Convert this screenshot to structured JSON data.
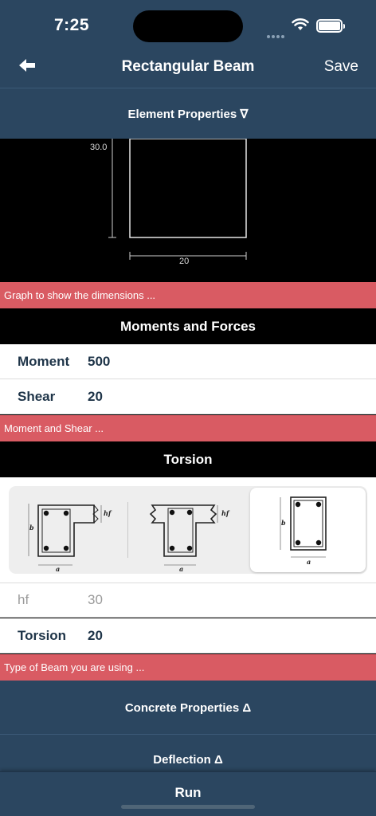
{
  "status_bar": {
    "time": "7:25",
    "icons": [
      "cellular-icon",
      "wifi-icon",
      "battery-icon"
    ]
  },
  "nav": {
    "back_icon": "arrow-left-icon",
    "title": "Rectangular Beam",
    "save_label": "Save"
  },
  "sections": {
    "element_properties": "Element Properties ∇",
    "concrete_properties": "Concrete Properties Δ",
    "deflection": "Deflection Δ"
  },
  "graph": {
    "height_label": "30.0",
    "width_label": "20",
    "hint": "Graph to show the dimensions ..."
  },
  "moments": {
    "header": "Moments and Forces",
    "rows": [
      {
        "label": "Moment",
        "value": "500"
      },
      {
        "label": "Shear",
        "value": "20"
      }
    ],
    "hint": "Moment and Shear ..."
  },
  "torsion": {
    "header": "Torsion",
    "beam_types": [
      {
        "name": "l-beam",
        "labels": [
          "b",
          "hf",
          "a"
        ],
        "selected": false
      },
      {
        "name": "t-beam",
        "labels": [
          "hf",
          "a"
        ],
        "selected": false
      },
      {
        "name": "rectangular-beam",
        "labels": [
          "b",
          "a"
        ],
        "selected": true
      }
    ],
    "rows": [
      {
        "label": "hf",
        "value": "30",
        "disabled": true
      },
      {
        "label": "Torsion",
        "value": "20",
        "disabled": false
      }
    ],
    "hint": "Type of Beam you are using ..."
  },
  "run_label": "Run",
  "colors": {
    "navy": "#2b4660",
    "hint_red": "#d95b63",
    "text_dark": "#1e3448"
  }
}
